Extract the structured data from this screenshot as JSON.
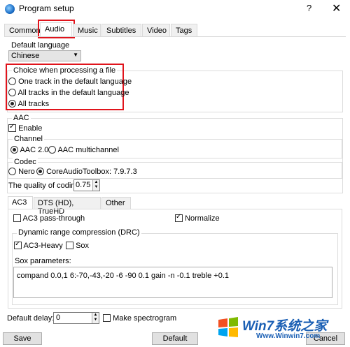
{
  "window": {
    "title": "Program setup",
    "help": "?",
    "close": "✕"
  },
  "tabs": [
    "Common",
    "Audio",
    "Music",
    "Subtitles",
    "Video",
    "Tags"
  ],
  "default_language": {
    "label": "Default language",
    "value": "Chinese"
  },
  "file_choice": {
    "label": "Choice when processing a file",
    "options": [
      "One track in the default language",
      "All tracks in the default language",
      "All tracks"
    ],
    "selected": 2
  },
  "aac": {
    "label": "AAC",
    "enable_label": "Enable",
    "enable_checked": true,
    "channel": {
      "label": "Channel",
      "options": [
        "AAC 2.0",
        "AAC multichannel"
      ],
      "selected": 0
    },
    "codec": {
      "label": "Codec",
      "options": [
        "Nero",
        "CoreAudioToolbox: 7.9.7.3"
      ],
      "selected": 1
    },
    "quality": {
      "label": "The quality of coding",
      "value": "0.75"
    }
  },
  "subtabs": [
    "AC3",
    "DTS (HD), TrueHD",
    "Other"
  ],
  "ac3": {
    "passthrough_label": "AC3 pass-through",
    "passthrough_checked": false,
    "normalize_label": "Normalize",
    "normalize_checked": true,
    "drc": {
      "label": "Dynamic range compression (DRC)",
      "heavy_label": "AC3-Heavy",
      "heavy_checked": true,
      "sox_label": "Sox",
      "sox_checked": false
    },
    "sox_params_label": "Sox parameters:",
    "sox_params_value": "compand 0.0,1 6:-70,-43,-20 -6 -90 0.1 gain -n -0.1 treble +0.1"
  },
  "footer": {
    "delay_label": "Default delay:",
    "delay_value": "0",
    "spectrogram_label": "Make spectrogram",
    "spectrogram_checked": false,
    "save": "Save",
    "default": "Default",
    "cancel": "Cancel"
  },
  "watermark": {
    "logo": "Win7系统之家",
    "url": "Www.Winwin7.com"
  }
}
